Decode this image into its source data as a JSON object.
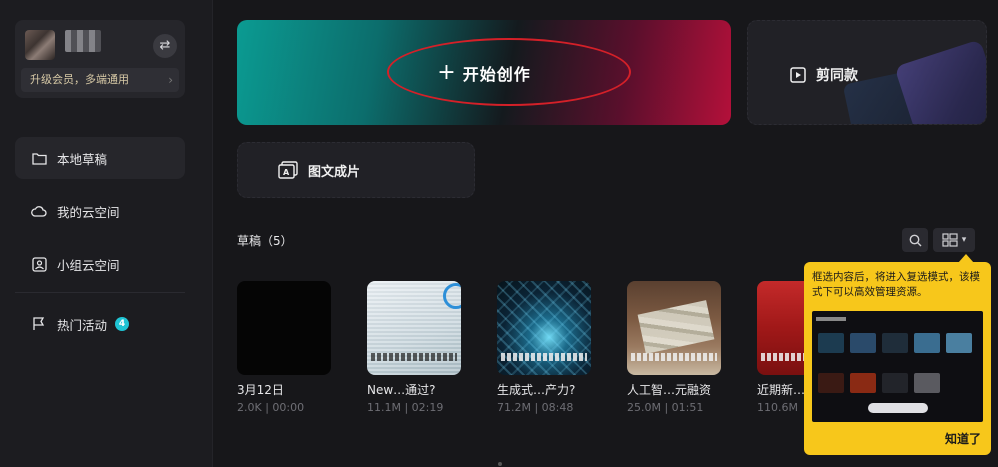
{
  "sidebar": {
    "vip_label": "升级会员，多端通用",
    "items": [
      {
        "label": "本地草稿",
        "icon": "folder-icon"
      },
      {
        "label": "我的云空间",
        "icon": "cloud-icon"
      },
      {
        "label": "小组云空间",
        "icon": "group-space-icon"
      },
      {
        "label": "热门活动",
        "icon": "flag-icon",
        "badge": "4"
      }
    ]
  },
  "main": {
    "create_label": "开始创作",
    "template_label": "剪同款",
    "imgtext_label": "图文成片",
    "drafts_title": "草稿（5）",
    "drafts": [
      {
        "name": "3月12日",
        "meta": "2.0K | 00:00"
      },
      {
        "name": "New…通过?",
        "meta": "11.1M | 02:19"
      },
      {
        "name": "生成式…产力?",
        "meta": "71.2M | 08:48"
      },
      {
        "name": "人工智…元融资",
        "meta": "25.0M | 01:51"
      },
      {
        "name": "近期新…",
        "meta": "110.6M"
      }
    ]
  },
  "tooltip": {
    "text": "框选内容后，将进入复选模式，该模式下可以高效管理资源。",
    "button": "知道了"
  },
  "colors": {
    "accent_teal": "#0b9b92",
    "accent_red": "#b4103a",
    "tooltip_yellow": "#f7c71b",
    "badge_cyan": "#1fc4d4"
  }
}
